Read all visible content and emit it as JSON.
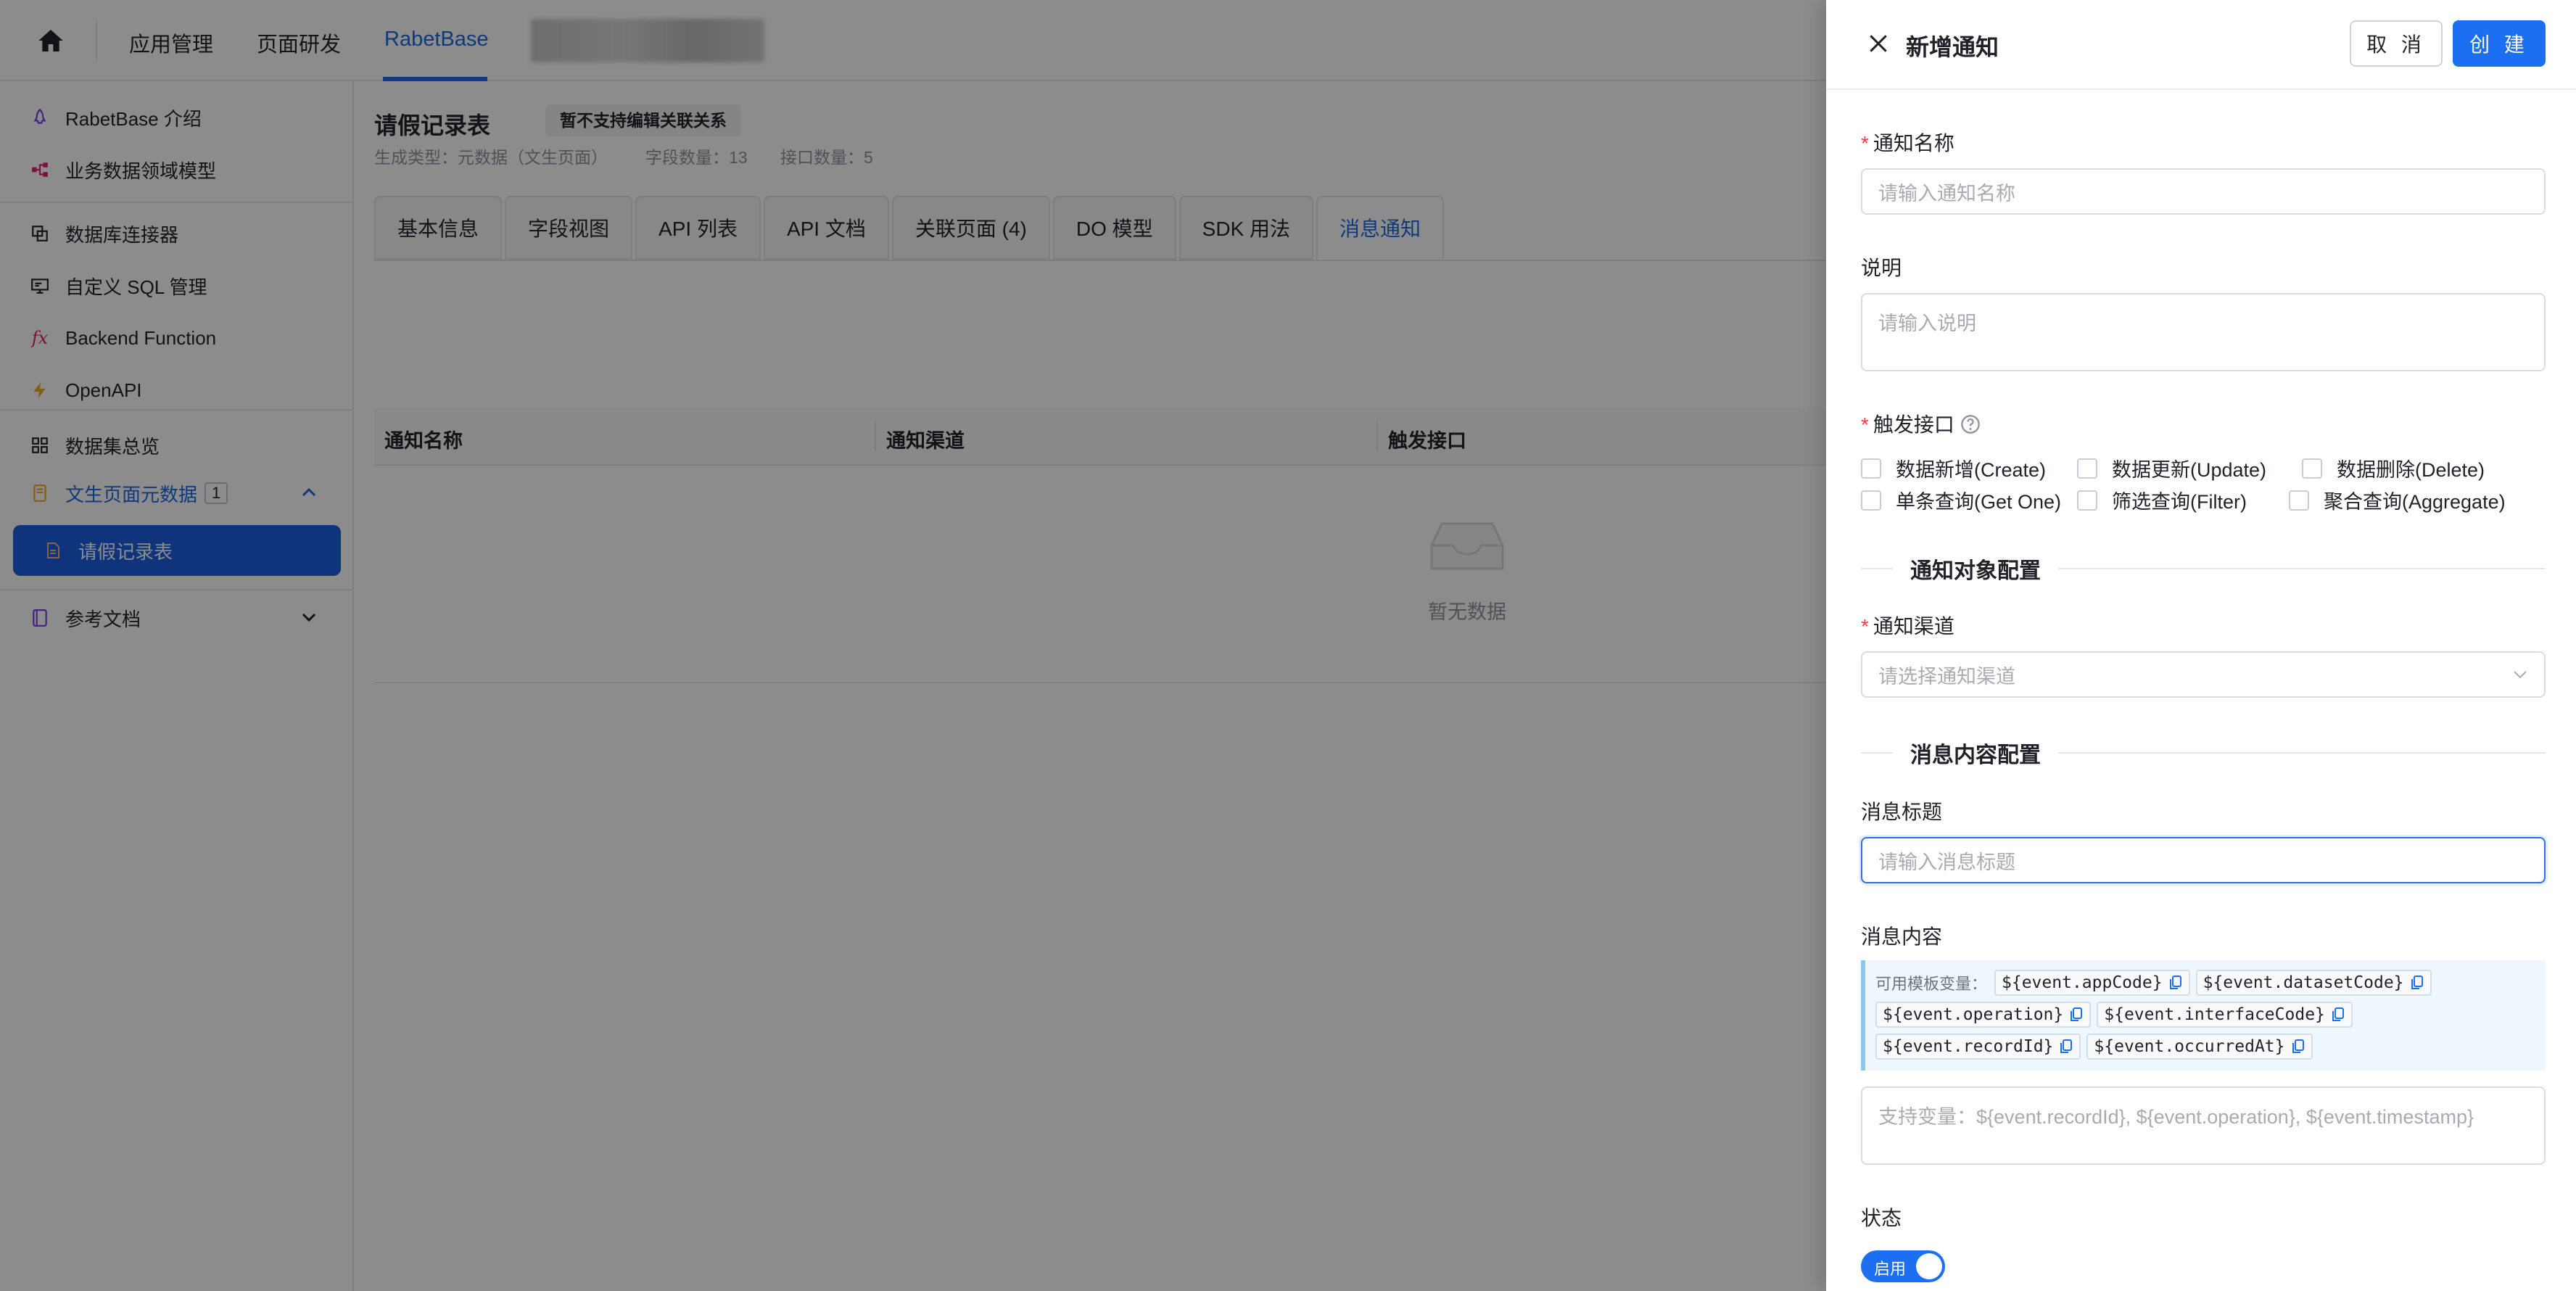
{
  "topbar": {
    "nav": [
      "应用管理",
      "页面研发",
      "RabetBase"
    ]
  },
  "sidebar": {
    "items": [
      {
        "label": "RabetBase 介绍",
        "icon": "rocket-icon"
      },
      {
        "label": "业务数据领域模型",
        "icon": "model-icon"
      },
      {
        "label": "数据库连接器",
        "icon": "database-icon"
      },
      {
        "label": "自定义 SQL 管理",
        "icon": "sql-icon"
      },
      {
        "label": "Backend Function",
        "icon": "fx-icon"
      },
      {
        "label": "OpenAPI",
        "icon": "lightning-icon"
      },
      {
        "label": "数据集总览",
        "icon": "grid-icon"
      }
    ],
    "group": {
      "label": "文生页面元数据",
      "badge": "1"
    },
    "active_item": "请假记录表",
    "docs": "参考文档"
  },
  "main": {
    "title": "请假记录表",
    "tag": "暂不支持编辑关联关系",
    "meta": [
      "生成类型：元数据（文生页面）",
      "字段数量：13",
      "接口数量：5"
    ],
    "tabs": [
      "基本信息",
      "字段视图",
      "API 列表",
      "API 文档",
      "关联页面 (4)",
      "DO 模型",
      "SDK 用法",
      "消息通知"
    ],
    "table_headers": [
      "通知名称",
      "通知渠道",
      "触发接口"
    ],
    "empty_text": "暂无数据"
  },
  "drawer": {
    "title": "新增通知",
    "cancel": "取 消",
    "create": "创 建",
    "name_label": "通知名称",
    "name_placeholder": "请输入通知名称",
    "desc_label": "说明",
    "desc_placeholder": "请输入说明",
    "trigger_label": "触发接口",
    "triggers_row1": [
      "数据新增(Create)",
      "数据更新(Update)",
      "数据删除(Delete)"
    ],
    "triggers_row2": [
      "单条查询(Get One)",
      "筛选查询(Filter)",
      "聚合查询(Aggregate)"
    ],
    "section_target": "通知对象配置",
    "channel_label": "通知渠道",
    "channel_placeholder": "请选择通知渠道",
    "section_content": "消息内容配置",
    "msg_title_label": "消息标题",
    "msg_title_placeholder": "请输入消息标题",
    "msg_content_label": "消息内容",
    "vars_hint": "可用模板变量：",
    "vars": [
      "${event.appCode}",
      "${event.datasetCode}",
      "${event.operation}",
      "${event.interfaceCode}",
      "${event.recordId}",
      "${event.occurredAt}"
    ],
    "content_placeholder": "支持变量：${event.recordId}, ${event.operation}, ${event.timestamp}",
    "status_label": "状态",
    "toggle_text": "启用"
  },
  "colors": {
    "primary": "#1d6ff2",
    "required": "#f53f3f"
  }
}
